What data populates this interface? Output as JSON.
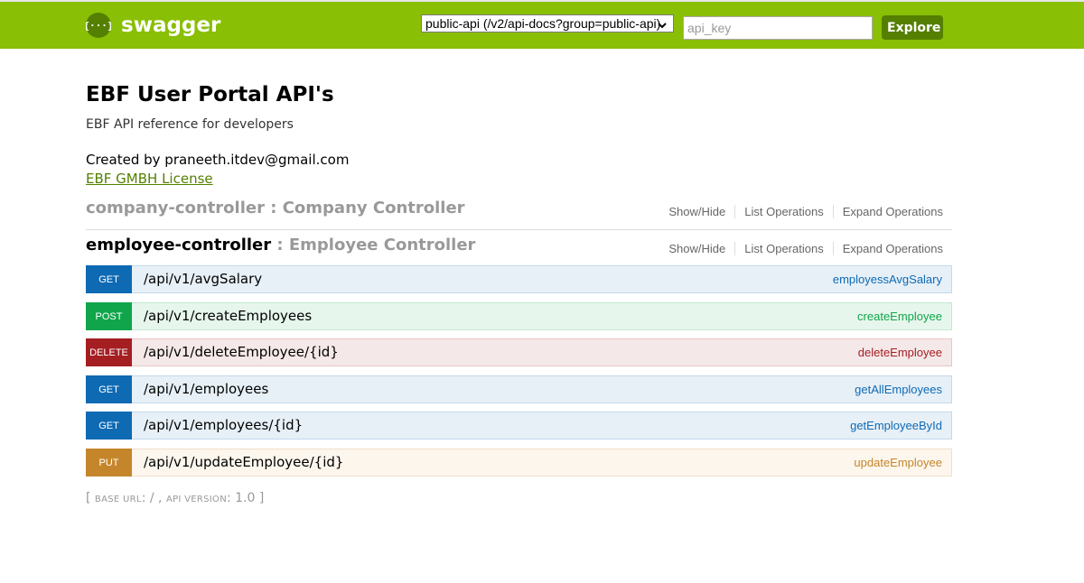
{
  "header": {
    "logo_text": "swagger",
    "logo_icon": "swagger-braces-icon",
    "api_select_value": "public-api (/v2/api-docs?group=public-api)",
    "api_key_placeholder": "api_key",
    "explore_label": "Explore",
    "colors": {
      "background": "#89bf04",
      "button": "#547f00"
    }
  },
  "info": {
    "title": "EBF User Portal API's",
    "description": "EBF API reference for developers",
    "created_by": "Created by praneeth.itdev@gmail.com",
    "license": "EBF GMBH License"
  },
  "resources": [
    {
      "name": "company-controller",
      "separator": " : ",
      "description": "Company Controller",
      "options": [
        "Show/Hide",
        "List Operations",
        "Expand Operations"
      ]
    },
    {
      "name": "employee-controller",
      "separator": " : ",
      "description": "Employee Controller",
      "options": [
        "Show/Hide",
        "List Operations",
        "Expand Operations"
      ]
    }
  ],
  "operations": [
    {
      "method": "GET",
      "path": "/api/v1/avgSalary",
      "nickname": "employessAvgSalary"
    },
    {
      "method": "POST",
      "path": "/api/v1/createEmployees",
      "nickname": "createEmployee"
    },
    {
      "method": "DELETE",
      "path": "/api/v1/deleteEmployee/{id}",
      "nickname": "deleteEmployee"
    },
    {
      "method": "GET",
      "path": "/api/v1/employees",
      "nickname": "getAllEmployees"
    },
    {
      "method": "GET",
      "path": "/api/v1/employees/{id}",
      "nickname": "getEmployeeById"
    },
    {
      "method": "PUT",
      "path": "/api/v1/updateEmployee/{id}",
      "nickname": "updateEmployee"
    }
  ],
  "method_colors": {
    "GET": "#0f6ab4",
    "POST": "#10a54a",
    "DELETE": "#a41e22",
    "PUT": "#c5862b"
  },
  "footer": {
    "open": "[ ",
    "base_url_label": "base url",
    "base_url_value": ": / , ",
    "api_version_label": "api version",
    "api_version_value": ": 1.0 ",
    "close": "]"
  }
}
